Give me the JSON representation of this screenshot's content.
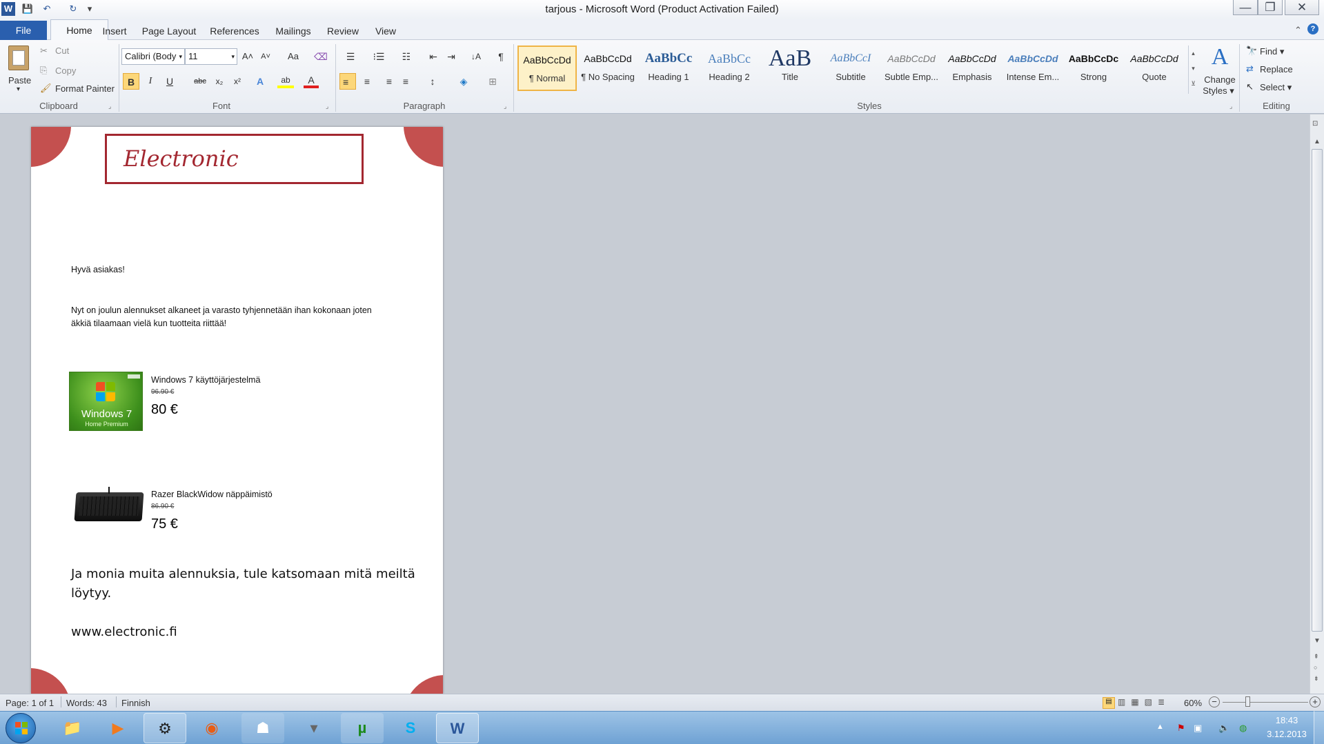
{
  "window": {
    "title": "tarjous - Microsoft Word (Product Activation Failed)"
  },
  "qat": {
    "word_icon": "W",
    "save_icon": "💾",
    "undo_icon": "↶",
    "redo_icon": "↻",
    "customize_icon": "▾"
  },
  "window_controls": {
    "minimize": "—",
    "restore": "❐",
    "close": "✕"
  },
  "tabs": {
    "file": "File",
    "home": "Home",
    "insert": "Insert",
    "page_layout": "Page Layout",
    "references": "References",
    "mailings": "Mailings",
    "review": "Review",
    "view": "View"
  },
  "clipboard": {
    "paste": "Paste",
    "cut": "Cut",
    "copy": "Copy",
    "format_painter": "Format Painter",
    "label": "Clipboard"
  },
  "font": {
    "name": "Calibri (Body",
    "size": "11",
    "grow": "A˄",
    "shrink": "A˅",
    "change_case": "Aa",
    "clear": "⌫",
    "bold": "B",
    "italic": "I",
    "underline": "U",
    "strike": "abc",
    "sub": "x₂",
    "sup": "x²",
    "effects": "A",
    "highlight": "ab",
    "color": "A",
    "label": "Font"
  },
  "paragraph": {
    "bullets": "☰",
    "numbering": "⁝☰",
    "multilevel": "☷",
    "dec_indent": "⇤",
    "inc_indent": "⇥",
    "sort": "↓A",
    "show_marks": "¶",
    "align_left": "≡",
    "center": "≡",
    "align_right": "≡",
    "justify": "≡",
    "line_spacing": "↕",
    "shading": "◈",
    "borders": "⊞",
    "label": "Paragraph"
  },
  "styles": {
    "label": "Styles",
    "items": [
      {
        "preview": "AaBbCcDd",
        "name": "¶ Normal"
      },
      {
        "preview": "AaBbCcDd",
        "name": "¶ No Spacing"
      },
      {
        "preview": "AaBbCc",
        "name": "Heading 1"
      },
      {
        "preview": "AaBbCc",
        "name": "Heading 2"
      },
      {
        "preview": "AaB",
        "name": "Title"
      },
      {
        "preview": "AaBbCcI",
        "name": "Subtitle"
      },
      {
        "preview": "AaBbCcDd",
        "name": "Subtle Emp..."
      },
      {
        "preview": "AaBbCcDd",
        "name": "Emphasis"
      },
      {
        "preview": "AaBbCcDd",
        "name": "Intense Em..."
      },
      {
        "preview": "AaBbCcDc",
        "name": "Strong"
      },
      {
        "preview": "AaBbCcDd",
        "name": "Quote"
      }
    ],
    "change_styles_l1": "Change",
    "change_styles_l2": "Styles"
  },
  "editing": {
    "find": "Find",
    "replace": "Replace",
    "select": "Select",
    "label": "Editing"
  },
  "document": {
    "logo": "Electronic",
    "greeting": "Hyvä asiakas!",
    "intro_1": "Nyt on joulun alennukset alkaneet ja varasto tyhjennetään ihan kokonaan joten",
    "intro_2": "äkkiä tilaamaan vielä kun tuotteita riittää!",
    "products": [
      {
        "name": "Windows 7 käyttöjärjestelmä",
        "old_price": "96.90 €",
        "price": "80 €",
        "image_text_1": "Windows 7",
        "image_text_2": "Home Premium"
      },
      {
        "name": "Razer BlackWidow näppäimistö",
        "old_price": "86.90 €",
        "price": "75 €"
      }
    ],
    "outro_1": "Ja monia muita alennuksia, tule katsomaan mitä meiltä",
    "outro_2": "löytyy.",
    "website": "www.electronic.fi"
  },
  "status": {
    "page": "Page: 1 of 1",
    "words": "Words: 43",
    "language": "Finnish",
    "zoom": "60%",
    "zoom_minus": "−",
    "zoom_plus": "+"
  },
  "taskbar": {
    "time": "18:43",
    "date": "3.12.2013"
  },
  "colors": {
    "accent": "#2a5fae",
    "logo_red": "#a32730",
    "corner_red": "#c4504f"
  }
}
